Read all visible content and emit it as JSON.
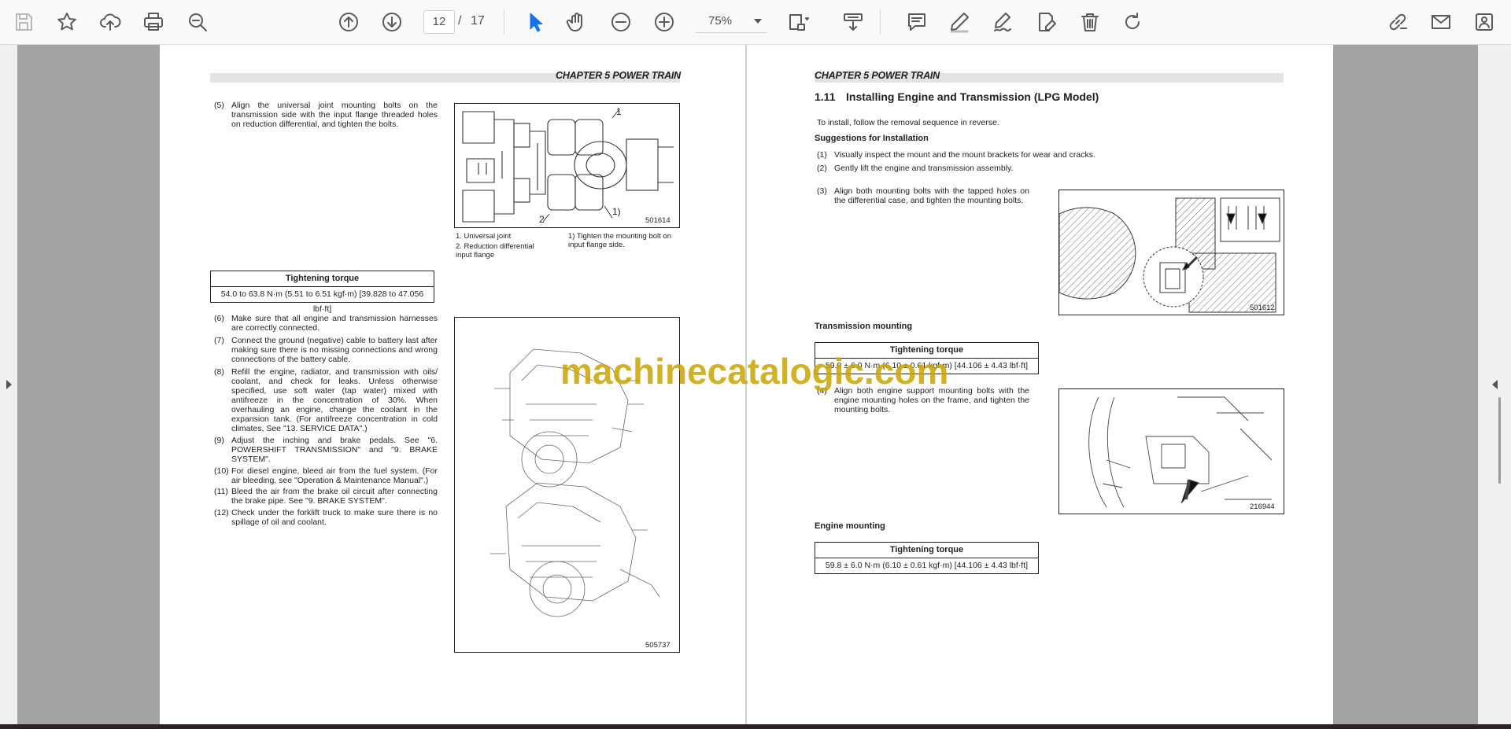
{
  "toolbar": {
    "page_current": "12",
    "page_separator": "/",
    "page_total": "17",
    "zoom": "75%",
    "icons": [
      "save-icon",
      "star-icon",
      "upload-icon",
      "print-icon",
      "zoom-search-icon",
      "page-up-icon",
      "page-down-icon",
      "select-cursor-icon",
      "hand-icon",
      "zoom-out-icon",
      "zoom-in-icon",
      "fit-page-icon",
      "scroll-mode-icon",
      "comment-icon",
      "pen-icon",
      "sign-icon",
      "edit-icon",
      "delete-icon",
      "rotate-icon",
      "link-icon",
      "mail-icon",
      "share-icon"
    ]
  },
  "watermark": "machinecatalogic.com",
  "left_page": {
    "chapter": "CHAPTER 5 POWER TRAIN",
    "step5_num": "(5)",
    "step5": "Align the universal joint mounting bolts on the transmission side with the input flange threaded holes on reduction differential, and tighten the bolts.",
    "fig1": {
      "code": "501614",
      "label1": "1",
      "label2": "2",
      "label3": "1)",
      "caption1": "1. Universal joint",
      "caption2": "2. Reduction differential input flange",
      "caption3": "1) Tighten the mounting bolt on input flange side."
    },
    "torque": {
      "header": "Tightening torque",
      "value": "54.0 to 63.8 N·m (5.51 to 6.51 kgf·m) [39.828 to 47.056 lbf·ft]"
    },
    "steps": [
      {
        "num": "(6)",
        "text": "Make sure that all engine and transmission harnesses are correctly connected."
      },
      {
        "num": "(7)",
        "text": "Connect the ground (negative) cable to battery last after making sure there is no missing connections and wrong connections of the battery cable."
      },
      {
        "num": "(8)",
        "text": "Refill the engine, radiator, and transmission with oils/ coolant, and check for leaks. Unless otherwise specified, use soft water (tap water) mixed with antifreeze in the concentration of 30%. When overhauling an engine, change the coolant in the expansion tank. (For antifreeze concentration in cold climates, See \"13. SERVICE DATA\".)"
      },
      {
        "num": "(9)",
        "text": "Adjust the inching and brake pedals. See \"6. POWERSHIFT TRANSMISSION\" and \"9. BRAKE SYSTEM\"."
      },
      {
        "num": "(10)",
        "text": "For diesel engine, bleed air from the fuel system. (For air bleeding, see \"Operation & Maintenance Manual\".)"
      },
      {
        "num": "(11)",
        "text": "Bleed the air from the brake oil circuit after connecting the brake pipe. See \"9. BRAKE SYSTEM\"."
      },
      {
        "num": "(12)",
        "text": "Check under the forklift truck to make sure there is no spillage of oil and coolant."
      }
    ],
    "fig2_code": "505737"
  },
  "right_page": {
    "chapter": "CHAPTER 5 POWER TRAIN",
    "section_num": "1.11",
    "section_title": "Installing Engine and Transmission (LPG Model)",
    "intro": "To install, follow the removal sequence in reverse.",
    "suggestions_title": "Suggestions for Installation",
    "suggestions": [
      {
        "num": "(1)",
        "text": "Visually inspect the mount and the mount brackets for wear and cracks."
      },
      {
        "num": "(2)",
        "text": "Gently lift the engine and transmission assembly."
      }
    ],
    "step3_num": "(3)",
    "step3": "Align both mounting bolts with the tapped holes on the differential case, and tighten the mounting bolts.",
    "fig3_code": "501612",
    "transmission_label": "Transmission mounting",
    "torque1": {
      "header": "Tightening torque",
      "value": "59.8 ± 6.0 N·m (6.10 ± 0.61 kgf·m) [44.106 ± 4.43 lbf·ft]"
    },
    "step4_num": "(4)",
    "step4": "Align both engine support mounting bolts with the engine mounting holes on the frame, and tighten the mounting bolts.",
    "fig4_code": "216944",
    "engine_label": "Engine mounting",
    "torque2": {
      "header": "Tightening torque",
      "value": "59.8 ± 6.0 N·m (6.10 ± 0.61 kgf·m) [44.106 ± 4.43 lbf·ft]"
    }
  }
}
